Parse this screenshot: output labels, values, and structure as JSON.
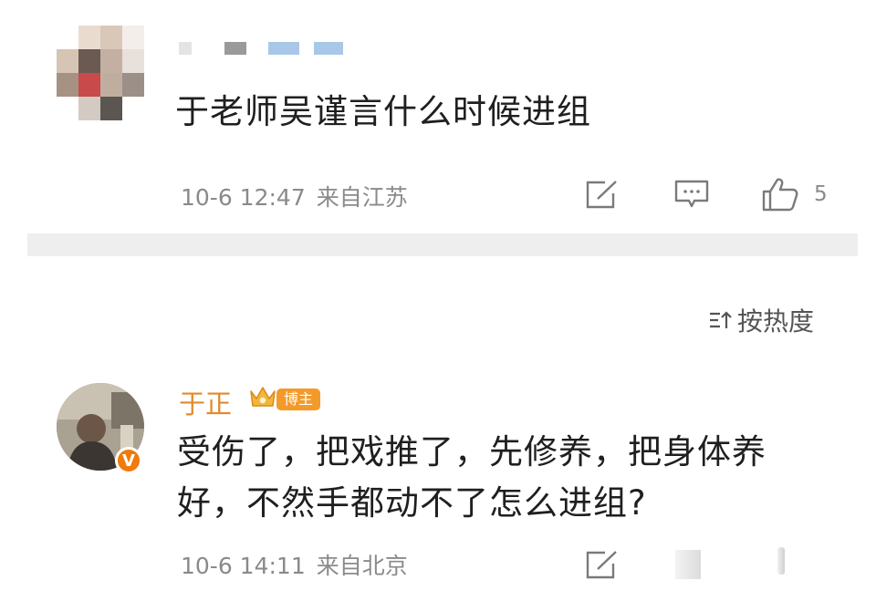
{
  "comment1": {
    "text": "于老师吴谨言什么时候进组",
    "date": "10-6 12:47",
    "location": "来自江苏",
    "like_count": "5"
  },
  "sort": {
    "label": "按热度"
  },
  "comment2": {
    "username": "于正",
    "badge": "博主",
    "verified": "V",
    "text": "受伤了，把戏推了，先修养，把身体养好，不然手都动不了怎么进组?",
    "date": "10-6 14:11",
    "location": "来自北京"
  },
  "icons": [
    "share-icon",
    "comment-icon",
    "like-icon",
    "sort-icon",
    "crown-icon"
  ],
  "colors": {
    "accent": "#e18a2c",
    "meta": "#8a8a8a",
    "divider": "#eeeeee"
  }
}
